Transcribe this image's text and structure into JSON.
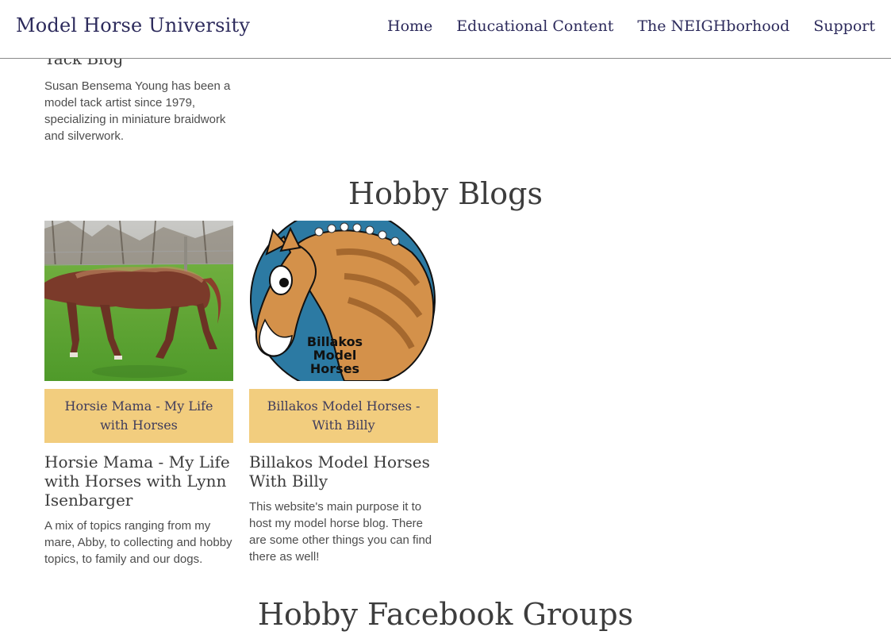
{
  "header": {
    "brand": "Model Horse University",
    "nav": [
      "Home",
      "Educational Content",
      "The NEIGHborhood",
      "Support"
    ]
  },
  "previous_card": {
    "title_fragment": "Tack Blog",
    "description": "Susan Bensema Young has been a model tack artist since 1979, specializing in miniature braidwork and silverwork."
  },
  "sections": {
    "hobby_blogs": "Hobby Blogs",
    "hobby_facebook_groups": "Hobby Facebook Groups"
  },
  "cards": [
    {
      "button": "Horsie Mama - My Life with Horses",
      "title": "Horsie Mama - My Life with Horses with Lynn Isenbarger",
      "description": "A mix of topics ranging from my mare, Abby, to collecting and hobby topics, to family and our dogs."
    },
    {
      "button": "Billakos Model Horses - With Billy",
      "title": "Billakos Model Horses With Billy",
      "description": "This website's main purpose it to host my model horse blog. There are some other things you can find there as well!",
      "logo_text": [
        "Billakos",
        "Model",
        "Horses"
      ]
    }
  ],
  "colors": {
    "brand": "#2d2b5c",
    "button_bg": "#f2cd7e",
    "logo_circle": "#2c7aa3",
    "horse_coat": "#d4914a"
  }
}
